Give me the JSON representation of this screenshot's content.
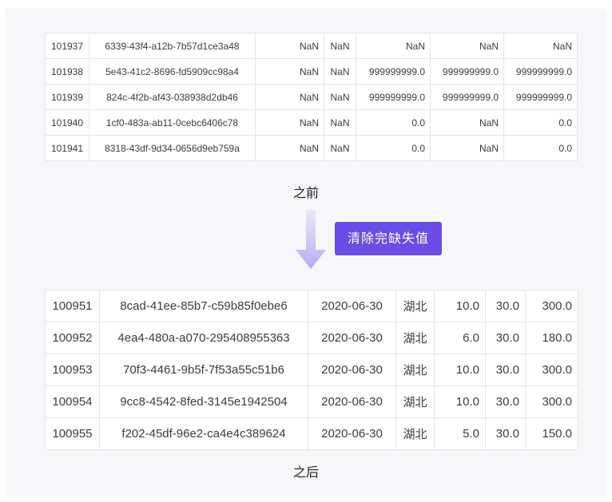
{
  "before_table": {
    "rows": [
      [
        "101937",
        "6339-43f4-a12b-7b57d1ce3a48",
        "NaN",
        "NaN",
        "NaN",
        "NaN",
        "NaN"
      ],
      [
        "101938",
        "5e43-41c2-8696-fd5909cc98a4",
        "NaN",
        "NaN",
        "999999999.0",
        "999999999.0",
        "999999999.0"
      ],
      [
        "101939",
        "824c-4f2b-af43-038938d2db46",
        "NaN",
        "NaN",
        "999999999.0",
        "999999999.0",
        "999999999.0"
      ],
      [
        "101940",
        "1cf0-483a-ab11-0cebc6406c78",
        "NaN",
        "NaN",
        "0.0",
        "NaN",
        "0.0"
      ],
      [
        "101941",
        "8318-43df-9d34-0656d9eb759a",
        "NaN",
        "NaN",
        "0.0",
        "NaN",
        "0.0"
      ]
    ]
  },
  "captions": {
    "before": "之前",
    "after": "之后"
  },
  "action": {
    "label": "清除完缺失值"
  },
  "colors": {
    "accent": "#6b4ce6",
    "arrow": "#c9bff3"
  },
  "after_table": {
    "rows": [
      [
        "100951",
        "8cad-41ee-85b7-c59b85f0ebe6",
        "2020-06-30",
        "湖北",
        "10.0",
        "30.0",
        "300.0"
      ],
      [
        "100952",
        "4ea4-480a-a070-295408955363",
        "2020-06-30",
        "湖北",
        "6.0",
        "30.0",
        "180.0"
      ],
      [
        "100953",
        "70f3-4461-9b5f-7f53a55c51b6",
        "2020-06-30",
        "湖北",
        "10.0",
        "30.0",
        "300.0"
      ],
      [
        "100954",
        "9cc8-4542-8fed-3145e1942504",
        "2020-06-30",
        "湖北",
        "10.0",
        "30.0",
        "300.0"
      ],
      [
        "100955",
        "f202-45df-96e2-ca4e4c389624",
        "2020-06-30",
        "湖北",
        "5.0",
        "30.0",
        "150.0"
      ]
    ]
  }
}
